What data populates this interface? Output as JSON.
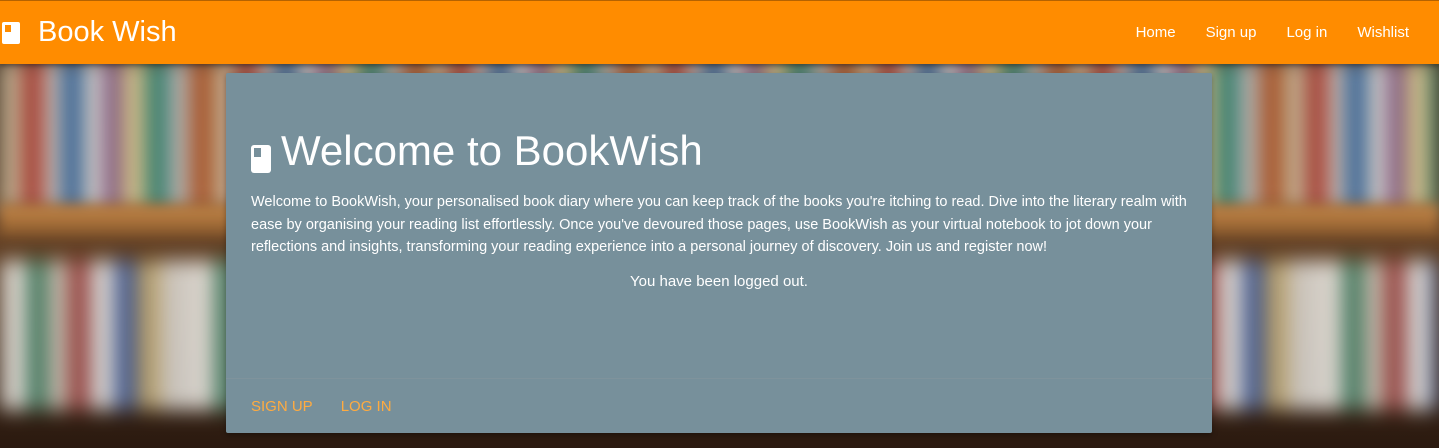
{
  "navbar": {
    "brand": "Book Wish",
    "brand_icon": "book-icon",
    "links": [
      "Home",
      "Sign up",
      "Log in",
      "Wishlist"
    ],
    "color": "#ff8c00"
  },
  "card": {
    "title": "Welcome to BookWish",
    "title_icon": "book-icon",
    "intro": "Welcome to BookWish, your personalised book diary where you can keep track of the books you're itching to read. Dive into the literary realm with ease by organising your reading list effortlessly. Once you've devoured those pages, use BookWish as your virtual notebook to jot down your reflections and insights, transforming your reading experience into a personal journey of discovery. Join us and register now!",
    "status_message": "You have been logged out.",
    "actions": [
      "SIGN UP",
      "LOG IN"
    ],
    "background": "#77909b",
    "action_color": "#ffab40"
  }
}
